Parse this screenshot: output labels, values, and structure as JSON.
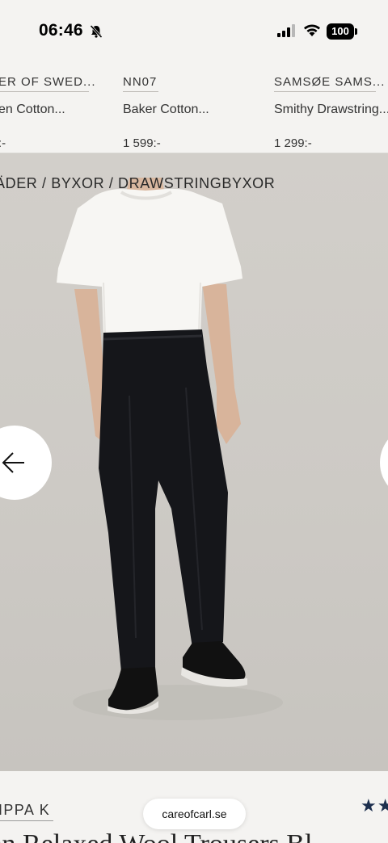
{
  "status_bar": {
    "time": "06:46",
    "battery": "100"
  },
  "carousel": {
    "items": [
      {
        "brand": "ER OF SWED...",
        "name": "en Cotton...",
        "price": ":-"
      },
      {
        "brand": "NN07",
        "name": "Baker Cotton...",
        "price": "1 599:-"
      },
      {
        "brand": "SAMSØE SAMS...",
        "name": "Smithy Drawstring...",
        "price": "1 299:-"
      }
    ]
  },
  "breadcrumb": "ÄDER / BYXOR / DRAWSTRINGBYXOR",
  "product": {
    "brand": "IPPA K",
    "title": "lan Relaxed Wool Trousers Bl",
    "stars": "★★"
  },
  "browser": {
    "url": "careofcarl.se"
  },
  "colors": {
    "accent_star": "#1d2f4e",
    "background": "#f4f3f1"
  }
}
